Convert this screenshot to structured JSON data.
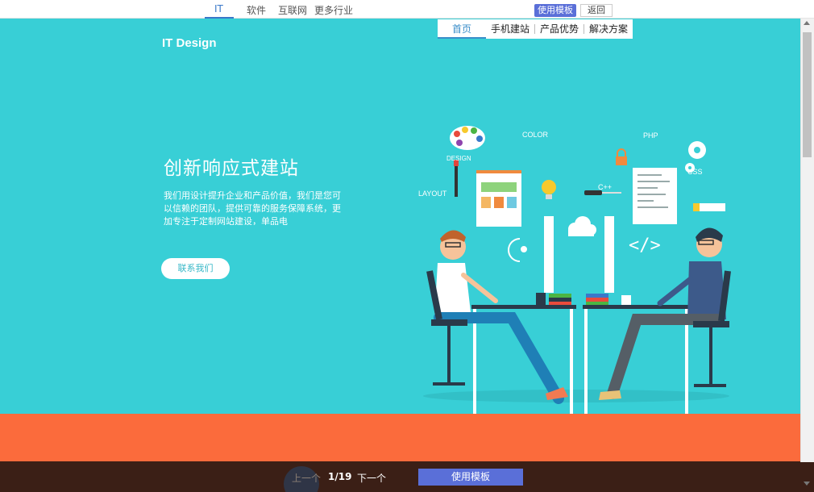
{
  "categories": [
    "IT",
    "软件",
    "互联网",
    "更多行业"
  ],
  "actions": {
    "use_template": "使用模板",
    "back": "返回"
  },
  "hero": {
    "brand": "IT Design",
    "nav": [
      "首页",
      "手机建站",
      "产品优势",
      "解决方案"
    ],
    "title": "创新响应式建站",
    "description": "我们用设计提升企业和产品价值，我们是您可以信赖的团队，提供可靠的服务保障系统，更加专注于定制网站建设，单品电",
    "contact_button": "联系我们",
    "illustration_labels": {
      "color": "COLOR",
      "php": "PHP",
      "design": "DESIGN",
      "css": "CSS",
      "layout": "LAYOUT",
      "cpp": "C++"
    }
  },
  "bottom": {
    "prev": "上一个",
    "pager": "1/19",
    "next": "下一个",
    "use_template": "使用模板"
  },
  "colors": {
    "hero_bg": "#38cfd6",
    "orange_band": "#fb6b3c",
    "bottom_bar": "#3b1f16",
    "accent": "#5a6fd8"
  }
}
